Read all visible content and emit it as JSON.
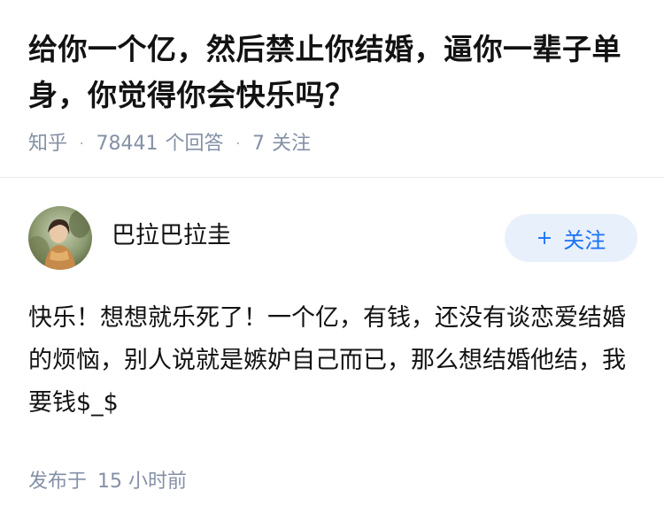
{
  "question": {
    "title": "给你一个亿，然后禁止你结婚，逼你一辈子单身，你觉得你会快乐吗？",
    "source": "知乎",
    "separator": "·",
    "answer_count": "78441",
    "answer_count_label": "个回答",
    "follower_count": "7",
    "follower_label": "关注"
  },
  "answer": {
    "author_name": "巴拉巴拉圭",
    "follow_plus": "+",
    "follow_label": "关注",
    "content": "快乐！想想就乐死了！一个亿，有钱，还没有谈恋爱结婚的烦恼，别人说就是嫉妒自己而已，那么想结婚他结，我要钱$_$",
    "time_prefix": "发布于",
    "time_value": "15 小时前"
  },
  "colors": {
    "text": "#121212",
    "meta": "#8590a6",
    "accent": "#1772f6",
    "follow_bg": "#e8f0fb",
    "divider": "#ebebeb"
  }
}
